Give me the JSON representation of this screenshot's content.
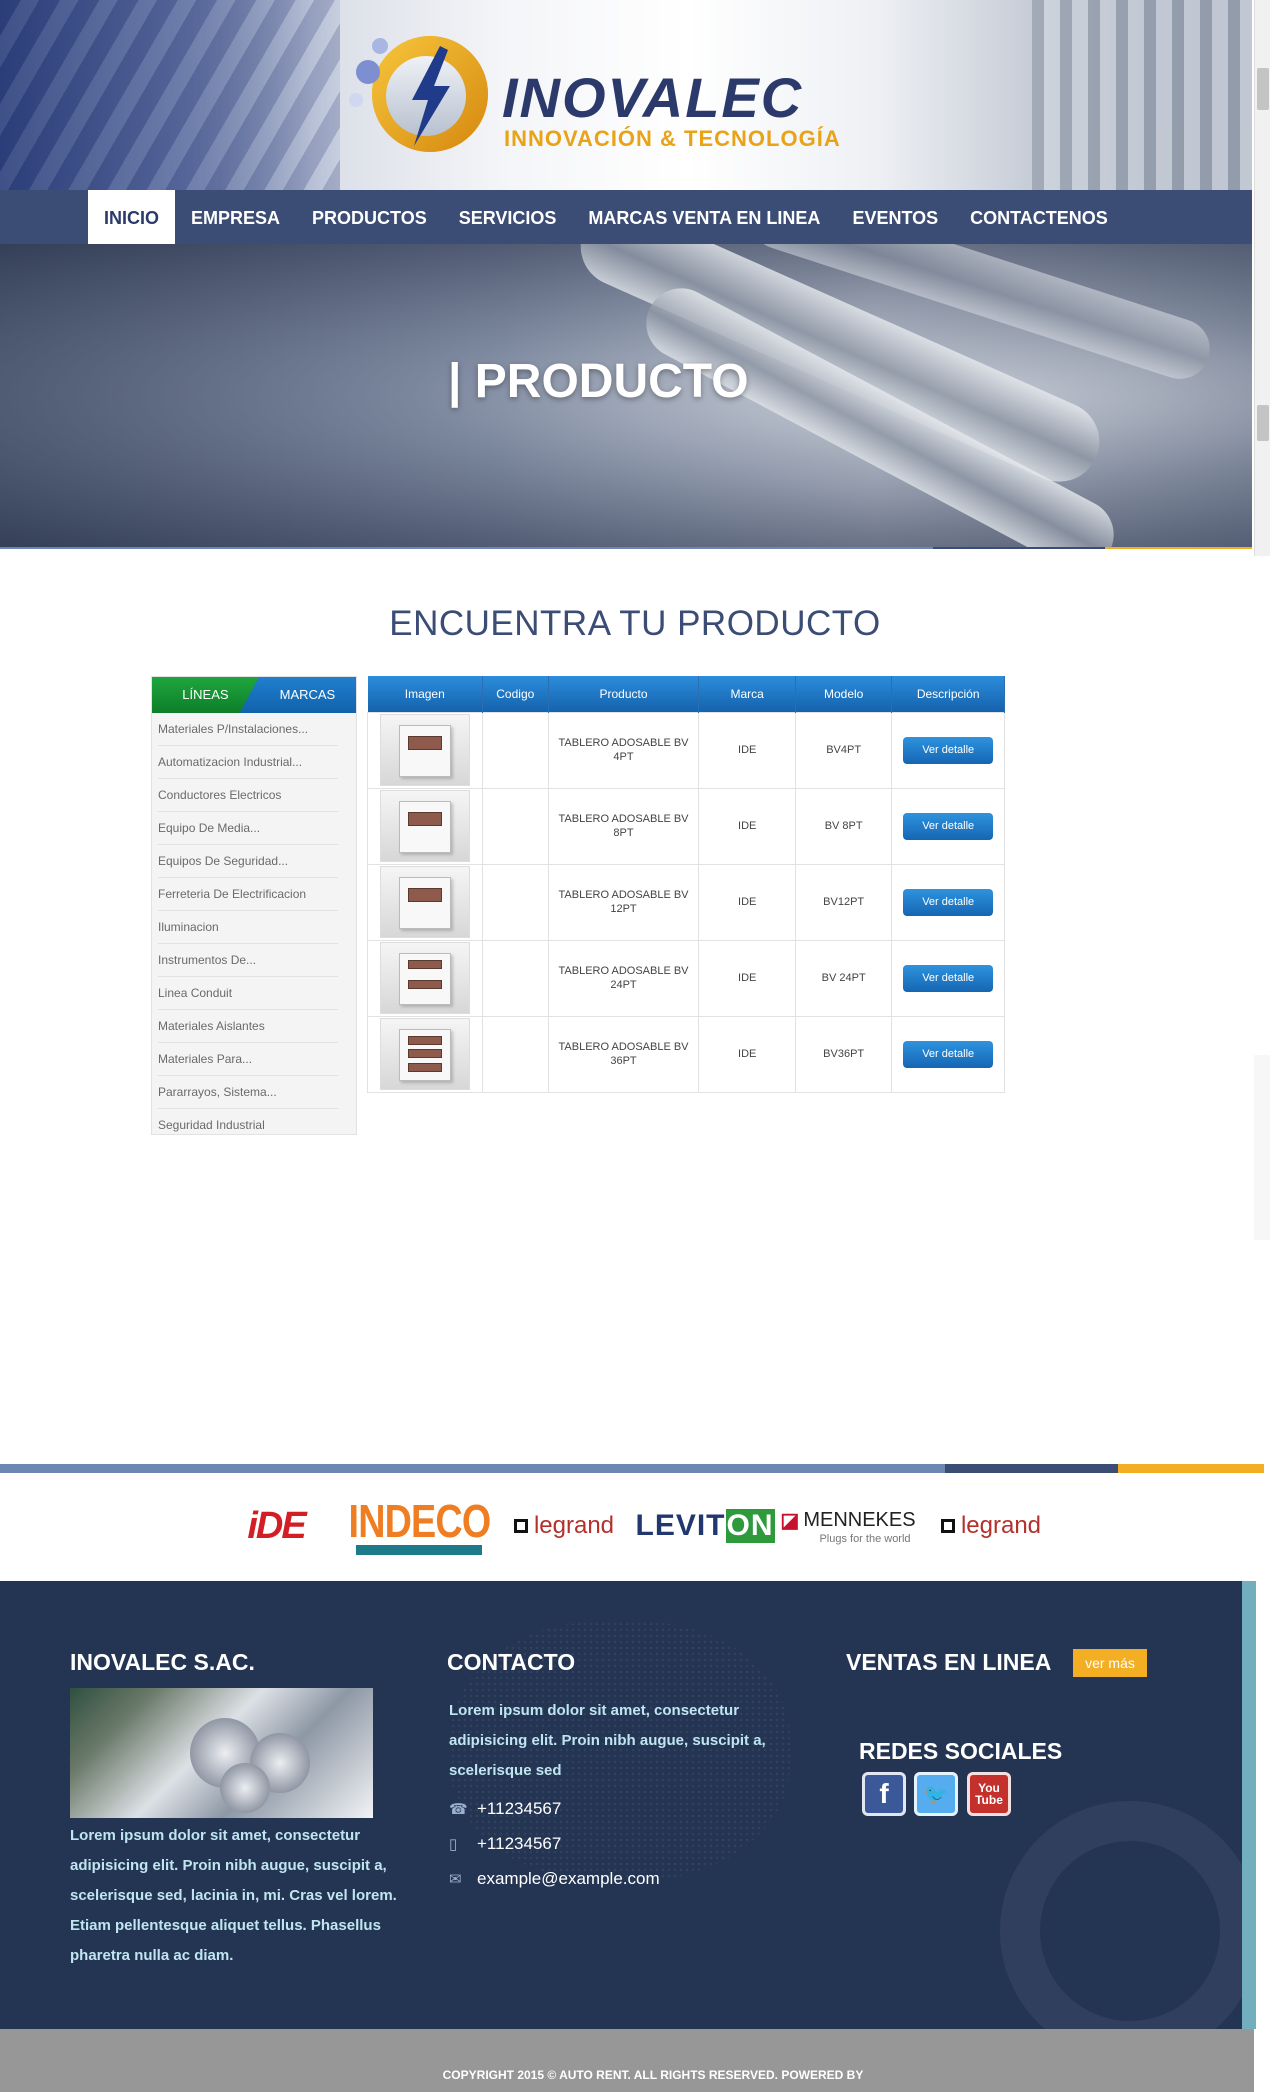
{
  "brand": {
    "name": "INOVALEC",
    "tagline": "INNOVACIÓN & TECNOLOGÍA"
  },
  "nav": {
    "items": [
      {
        "label": "INICIO",
        "active": true
      },
      {
        "label": "EMPRESA",
        "active": false
      },
      {
        "label": "PRODUCTOS",
        "active": false
      },
      {
        "label": "SERVICIOS",
        "active": false
      },
      {
        "label": "MARCAS VENTA EN LINEA",
        "active": false
      },
      {
        "label": "EVENTOS",
        "active": false
      },
      {
        "label": "CONTACTENOS",
        "active": false
      }
    ]
  },
  "hero": {
    "title": "| PRODUCTO"
  },
  "section": {
    "title": "ENCUENTRA TU PRODUCTO"
  },
  "sidebar": {
    "tabs": [
      "LÍNEAS",
      "MARCAS"
    ],
    "items": [
      "Materiales P/Instalaciones...",
      "Automatizacion Industrial...",
      "Conductores Electricos",
      "Equipo De Media...",
      "Equipos De Seguridad...",
      "Ferreteria De Electrificacion",
      "Iluminacion",
      "Instrumentos De...",
      "Linea Conduit",
      "Materiales Aislantes",
      "Materiales Para...",
      "Pararrayos, Sistema...",
      "Seguridad Industrial"
    ]
  },
  "table": {
    "headers": [
      "Imagen",
      "Codigo",
      "Producto",
      "Marca",
      "Modelo",
      "Descripción"
    ],
    "button_label": "Ver detalle",
    "rows": [
      {
        "codigo": "",
        "producto": "TABLERO ADOSABLE BV 4PT",
        "marca": "IDE",
        "modelo": "BV4PT",
        "windows": 1
      },
      {
        "codigo": "",
        "producto": "TABLERO ADOSABLE BV 8PT",
        "marca": "IDE",
        "modelo": "BV 8PT",
        "windows": 1
      },
      {
        "codigo": "",
        "producto": "TABLERO ADOSABLE BV 12PT",
        "marca": "IDE",
        "modelo": "BV12PT",
        "windows": 1
      },
      {
        "codigo": "",
        "producto": "TABLERO ADOSABLE BV 24PT",
        "marca": "IDE",
        "modelo": "BV 24PT",
        "windows": 2
      },
      {
        "codigo": "",
        "producto": "TABLERO ADOSABLE BV 36PT",
        "marca": "IDE",
        "modelo": "BV36PT",
        "windows": 3
      }
    ]
  },
  "brands": {
    "ide": "iDE",
    "indeco": "INDECO",
    "legrand": "legrand",
    "leviton_lev": "LEVIT",
    "leviton_on": "ON",
    "mennekes": "MENNEKES",
    "mennekes_sub": "Plugs for the world"
  },
  "footer": {
    "company": {
      "title": "INOVALEC S.AC.",
      "text": "Lorem ipsum dolor sit amet, consectetur adipisicing elit. Proin nibh augue, suscipit a, scelerisque sed, lacinia in, mi. Cras vel lorem. Etiam pellentesque aliquet tellus. Phasellus pharetra nulla ac diam."
    },
    "contact": {
      "title": "CONTACTO",
      "text": "Lorem ipsum dolor sit amet, consectetur adipisicing elit. Proin nibh augue, suscipit a, scelerisque sed",
      "phone1": "+11234567",
      "phone2": "+11234567",
      "email": "example@example.com"
    },
    "sales": {
      "title": "VENTAS EN LINEA",
      "button": "ver más"
    },
    "social": {
      "title": "REDES SOCIALES",
      "icons": [
        "facebook-icon",
        "twitter-icon",
        "youtube-icon"
      ]
    }
  },
  "copyright": "COPYRIGHT 2015 © AUTO RENT. ALL RIGHTS RESERVED.  POWERED BY",
  "colors": {
    "navy": "#3b4c75",
    "accent": "#f4ae23",
    "button_blue": "#1566b3",
    "footer_bg": "#243453"
  }
}
